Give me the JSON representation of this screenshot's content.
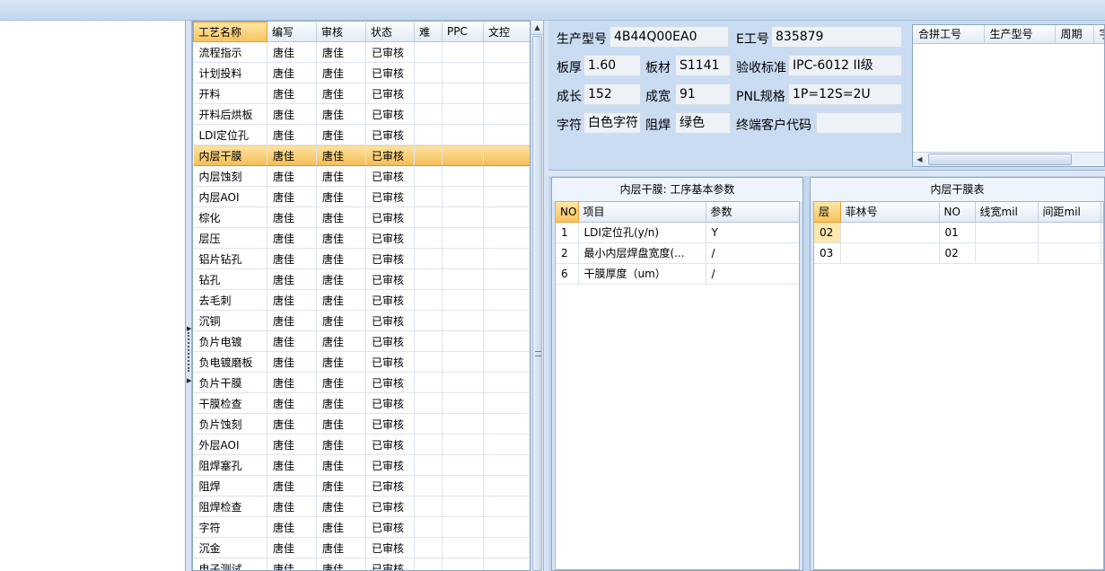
{
  "process_grid": {
    "columns": [
      "工艺名称",
      "编写",
      "审核",
      "状态",
      "难",
      "PPC",
      "文控"
    ],
    "selected_index": 5,
    "rows": [
      [
        "流程指示",
        "唐佳",
        "唐佳",
        "已审核",
        "",
        "",
        ""
      ],
      [
        "计划投料",
        "唐佳",
        "唐佳",
        "已审核",
        "",
        "",
        ""
      ],
      [
        "开料",
        "唐佳",
        "唐佳",
        "已审核",
        "",
        "",
        ""
      ],
      [
        "开料后烘板",
        "唐佳",
        "唐佳",
        "已审核",
        "",
        "",
        ""
      ],
      [
        "LDI定位孔",
        "唐佳",
        "唐佳",
        "已审核",
        "",
        "",
        ""
      ],
      [
        "内层干膜",
        "唐佳",
        "唐佳",
        "已审核",
        "",
        "",
        ""
      ],
      [
        "内层蚀刻",
        "唐佳",
        "唐佳",
        "已审核",
        "",
        "",
        ""
      ],
      [
        "内层AOI",
        "唐佳",
        "唐佳",
        "已审核",
        "",
        "",
        ""
      ],
      [
        "棕化",
        "唐佳",
        "唐佳",
        "已审核",
        "",
        "",
        ""
      ],
      [
        "层压",
        "唐佳",
        "唐佳",
        "已审核",
        "",
        "",
        ""
      ],
      [
        "铝片钻孔",
        "唐佳",
        "唐佳",
        "已审核",
        "",
        "",
        ""
      ],
      [
        "钻孔",
        "唐佳",
        "唐佳",
        "已审核",
        "",
        "",
        ""
      ],
      [
        "去毛刺",
        "唐佳",
        "唐佳",
        "已审核",
        "",
        "",
        ""
      ],
      [
        "沉铜",
        "唐佳",
        "唐佳",
        "已审核",
        "",
        "",
        ""
      ],
      [
        "负片电镀",
        "唐佳",
        "唐佳",
        "已审核",
        "",
        "",
        ""
      ],
      [
        "负电镀磨板",
        "唐佳",
        "唐佳",
        "已审核",
        "",
        "",
        ""
      ],
      [
        "负片干膜",
        "唐佳",
        "唐佳",
        "已审核",
        "",
        "",
        ""
      ],
      [
        "干膜检查",
        "唐佳",
        "唐佳",
        "已审核",
        "",
        "",
        ""
      ],
      [
        "负片蚀刻",
        "唐佳",
        "唐佳",
        "已审核",
        "",
        "",
        ""
      ],
      [
        "外层AOI",
        "唐佳",
        "唐佳",
        "已审核",
        "",
        "",
        ""
      ],
      [
        "阻焊塞孔",
        "唐佳",
        "唐佳",
        "已审核",
        "",
        "",
        ""
      ],
      [
        "阻焊",
        "唐佳",
        "唐佳",
        "已审核",
        "",
        "",
        ""
      ],
      [
        "阻焊检查",
        "唐佳",
        "唐佳",
        "已审核",
        "",
        "",
        ""
      ],
      [
        "字符",
        "唐佳",
        "唐佳",
        "已审核",
        "",
        "",
        ""
      ],
      [
        "沉金",
        "唐佳",
        "唐佳",
        "已审核",
        "",
        "",
        ""
      ],
      [
        "电子测试",
        "唐佳",
        "唐佳",
        "已审核",
        "",
        "",
        ""
      ]
    ]
  },
  "info": {
    "model_label": "生产型号",
    "model_value": "4B44Q00EA0",
    "ework_label": "E工号",
    "ework_value": "835879",
    "thickness_label": "板厚",
    "thickness_value": "1.60",
    "material_label": "板材",
    "material_value": "S1141",
    "standard_label": "验收标准",
    "standard_value": "IPC-6012 II级",
    "length_label": "成长",
    "length_value": "152",
    "width_label": "成宽",
    "width_value": "91",
    "pnl_label": "PNL规格",
    "pnl_value": "1P=12S=2U",
    "char_label": "字符",
    "char_value": "白色字符",
    "mask_label": "阻焊",
    "mask_value": "绿色",
    "customer_label": "终端客户代码",
    "customer_value": ""
  },
  "merge_grid": {
    "columns": [
      "合拼工号",
      "生产型号",
      "周期",
      "字"
    ]
  },
  "params_panel": {
    "title": "内层干膜: 工序基本参数",
    "columns": [
      "NO",
      "项目",
      "参数"
    ],
    "rows": [
      [
        "1",
        "LDI定位孔(y/n)",
        "Y"
      ],
      [
        "2",
        "最小内层焊盘宽度(...",
        "/"
      ],
      [
        "6",
        "干膜厚度（um）",
        "/"
      ]
    ]
  },
  "film_panel": {
    "title": "内层干膜表",
    "columns": [
      "层",
      "菲林号",
      "NO",
      "线宽mil",
      "间距mil",
      ""
    ],
    "rows": [
      [
        "02",
        "",
        "01",
        "",
        "",
        ""
      ],
      [
        "03",
        "",
        "02",
        "",
        "",
        ""
      ]
    ]
  }
}
